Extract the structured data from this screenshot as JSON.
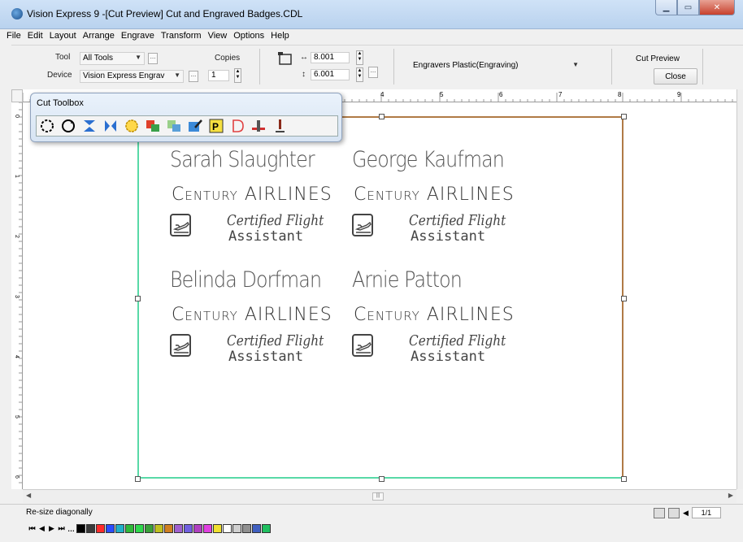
{
  "window": {
    "title": "Vision Express 9 -[Cut Preview] Cut and Engraved Badges.CDL"
  },
  "menu": [
    "File",
    "Edit",
    "Layout",
    "Arrange",
    "Engrave",
    "Transform",
    "View",
    "Options",
    "Help"
  ],
  "propbar": {
    "tool_label": "Tool",
    "tool_value": "All Tools",
    "device_label": "Device",
    "device_value": "Vision Express Engrav",
    "copies_label": "Copies",
    "copies_value": "1",
    "width_value": "8.001",
    "height_value": "6.001",
    "material_value": "Engravers Plastic(Engraving)",
    "cut_preview_label": "Cut Preview",
    "close_label": "Close"
  },
  "ruler": {
    "h_numbers": [
      "4",
      "5",
      "6",
      "7",
      "8",
      "9"
    ],
    "v_numbers": [
      "0",
      "1",
      "2",
      "3",
      "4",
      "5",
      "6"
    ]
  },
  "toolbox": {
    "title": "Cut Toolbox"
  },
  "badges": [
    {
      "name": "Sarah Slaughter",
      "airline": "Century AIRLINES",
      "cert": "Certified Flight",
      "role": "Assistant"
    },
    {
      "name": "George Kaufman",
      "airline": "Century AIRLINES",
      "cert": "Certified Flight",
      "role": "Assistant"
    },
    {
      "name": "Belinda Dorfman",
      "airline": "Century AIRLINES",
      "cert": "Certified Flight",
      "role": "Assistant"
    },
    {
      "name": "Arnie Patton",
      "airline": "Century AIRLINES",
      "cert": "Certified Flight",
      "role": "Assistant"
    }
  ],
  "status": {
    "text": "Re-size diagonally",
    "page": "1/1"
  },
  "colors": {
    "sheet_left_bottom": "#58d9a7",
    "sheet_top_right": "#b07a45",
    "palette": [
      "#000000",
      "#3a3a3a",
      "#ff2a2a",
      "#2a4cff",
      "#20b0c8",
      "#2fb93a",
      "#2fd84d",
      "#3aa03a",
      "#c0c020",
      "#d08020",
      "#a060d0",
      "#7060e0",
      "#b040c0",
      "#e040e0",
      "#f0e030",
      "#ffffff",
      "#d0d0d0",
      "#909090",
      "#4060c0",
      "#20c060"
    ]
  }
}
